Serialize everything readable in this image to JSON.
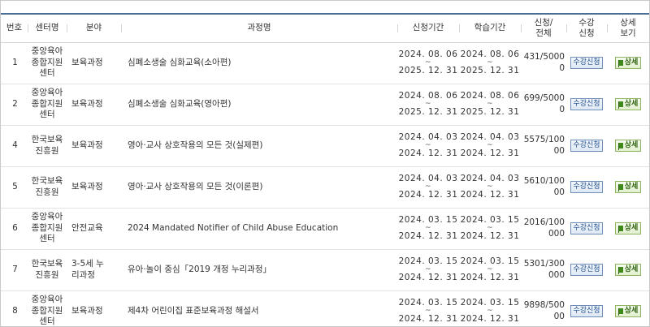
{
  "table": {
    "headers": {
      "no": "번호",
      "center": "센터명",
      "field": "분야",
      "course": "과정명",
      "apply_period": "신청기간",
      "study_period": "학습기간",
      "count": "신청/\n전체",
      "enroll": "수강\n신청",
      "detail": "상세\n보기"
    },
    "apply_label": "수강신청",
    "detail_label": "상세",
    "tilde": "~",
    "rows": [
      {
        "no": "1",
        "center": "중앙육아\n종합지원\n센터",
        "field": "보육과정",
        "course": "심폐소생술 심화교육(소아편)",
        "apply_start": "2024. 08. 06",
        "apply_end": "2025. 12. 31",
        "study_start": "2024. 08. 06",
        "study_end": "2025. 12. 31",
        "count": "431/50000"
      },
      {
        "no": "2",
        "center": "중앙육아\n종합지원\n센터",
        "field": "보육과정",
        "course": "심폐소생술 심화교육(영아편)",
        "apply_start": "2024. 08. 06",
        "apply_end": "2025. 12. 31",
        "study_start": "2024. 08. 06",
        "study_end": "2025. 12. 31",
        "count": "699/50000"
      },
      {
        "no": "4",
        "center": "한국보육\n진흥원",
        "field": "보육과정",
        "course": "영아·교사 상호작용의 모든 것(실제편)",
        "apply_start": "2024. 04. 03",
        "apply_end": "2024. 12. 31",
        "study_start": "2024. 04. 03",
        "study_end": "2024. 12. 31",
        "count": "5575/10000"
      },
      {
        "no": "5",
        "center": "한국보육\n진흥원",
        "field": "보육과정",
        "course": "영아·교사 상호작용의 모든 것(이론편)",
        "apply_start": "2024. 04. 03",
        "apply_end": "2024. 12. 31",
        "study_start": "2024. 04. 03",
        "study_end": "2024. 12. 31",
        "count": "5610/10000"
      },
      {
        "no": "6",
        "center": "중앙육아\n종합지원\n센터",
        "field": "안전교육",
        "course": "2024 Mandated Notifier of Child Abuse Education",
        "apply_start": "2024. 03. 15",
        "apply_end": "2024. 12. 31",
        "study_start": "2024. 03. 15",
        "study_end": "2024. 12. 31",
        "count": "2016/100000"
      },
      {
        "no": "7",
        "center": "한국보육\n진흥원",
        "field": "3-5세 누\n리과정",
        "course": "유아·놀이 중심「2019 개정 누리과정」",
        "apply_start": "2024. 03. 15",
        "apply_end": "2024. 12. 31",
        "study_start": "2024. 03. 15",
        "study_end": "2024. 12. 31",
        "count": "5301/300000"
      },
      {
        "no": "8",
        "center": "중앙육아\n종합지원\n센터",
        "field": "보육과정",
        "course": "제4차 어린이집 표준보육과정 해설서",
        "apply_start": "2024. 03. 15",
        "apply_end": "2024. 12. 31",
        "study_start": "2024. 03. 15",
        "study_end": "2024. 12. 31",
        "count": "9898/50000"
      }
    ]
  }
}
